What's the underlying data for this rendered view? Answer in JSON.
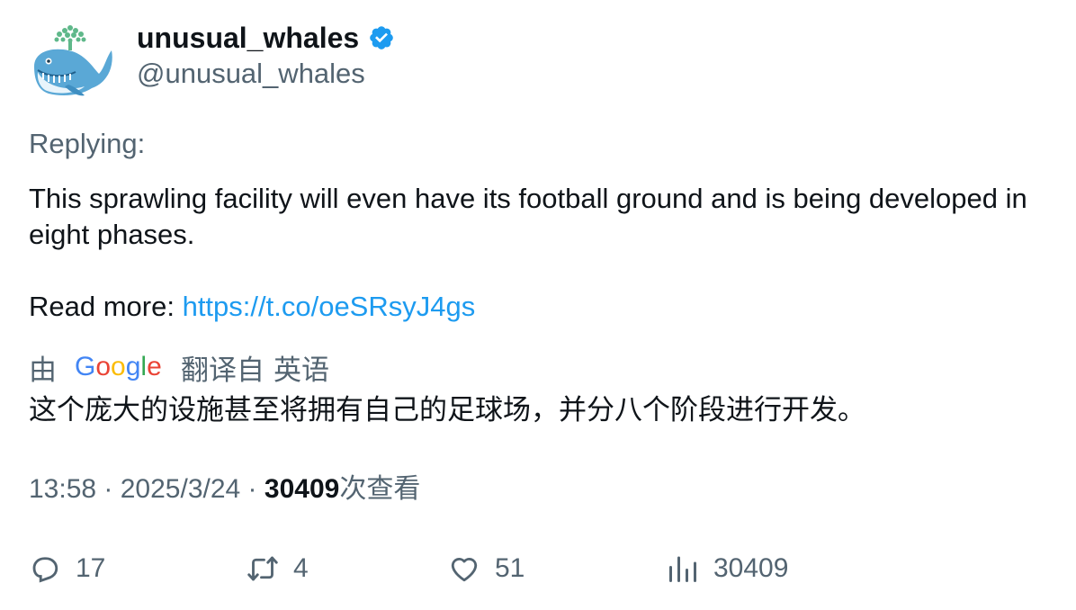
{
  "author": {
    "display_name": "unusual_whales",
    "handle": "@unusual_whales",
    "avatar_icon": "whale-logo-icon",
    "verified_icon": "verified-badge-icon",
    "verified_color": "#1d9bf0"
  },
  "tweet": {
    "replying_label": "Replying:",
    "text": "This sprawling facility will even have its football ground and is being developed in eight phases.",
    "read_more_label": "Read more: ",
    "link": "https://t.co/oeSRsyJ4gs",
    "link_color": "#1d9bf0"
  },
  "translation": {
    "by_label": "由",
    "provider_logo_icon": "google-logo-icon",
    "provider_logo_text": "Google",
    "translated_from_label": "翻译自",
    "source_language": "英语",
    "translated_text": "这个庞大的设施甚至将拥有自己的足球场，并分八个阶段进行开发。"
  },
  "meta": {
    "time": "13:58",
    "separator": " · ",
    "date": "2025/3/24",
    "views_count": "30409",
    "views_label": "次查看"
  },
  "actions": {
    "reply": {
      "icon": "reply-icon",
      "count": "17"
    },
    "retweet": {
      "icon": "retweet-icon",
      "count": "4"
    },
    "like": {
      "icon": "heart-icon",
      "count": "51"
    },
    "views": {
      "icon": "views-chart-icon",
      "count": "30409"
    }
  }
}
